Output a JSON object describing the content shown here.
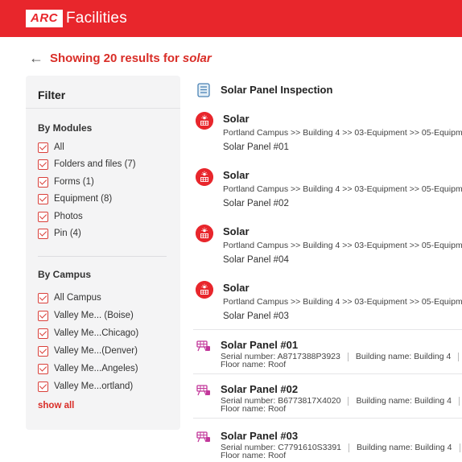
{
  "app": {
    "logo_box": "ARC",
    "logo_text": "Facilities",
    "brand_color": "#e8262c"
  },
  "header": {
    "back_icon": "arrow-left-icon",
    "results_text": "Showing 20 results for",
    "query": "solar"
  },
  "filter": {
    "title": "Filter",
    "modules": {
      "title": "By Modules",
      "items": [
        {
          "label": "All",
          "checked": true
        },
        {
          "label": "Folders and files (7)",
          "checked": true
        },
        {
          "label": "Forms (1)",
          "checked": true
        },
        {
          "label": "Equipment (8)",
          "checked": true
        },
        {
          "label": "Photos",
          "checked": true
        },
        {
          "label": "Pin (4)",
          "checked": true
        }
      ]
    },
    "campus": {
      "title": "By Campus",
      "items": [
        {
          "label": "All Campus",
          "checked": true
        },
        {
          "label": "Valley Me... (Boise)",
          "checked": true
        },
        {
          "label": "Valley Me...Chicago)",
          "checked": true
        },
        {
          "label": "Valley Me...(Denver)",
          "checked": true
        },
        {
          "label": "Valley Me...Angeles)",
          "checked": true
        },
        {
          "label": "Valley Me...ortland)",
          "checked": true
        }
      ],
      "show_all": "show all"
    }
  },
  "results": {
    "form": {
      "title": "Solar Panel Inspection",
      "icon": "form-document-icon"
    },
    "pins": [
      {
        "title": "Solar",
        "path": "Portland Campus >> Building 4 >> 03-Equipment >> 05-Equipme",
        "sub": "Solar Panel #01",
        "icon": "solar-pin-icon"
      },
      {
        "title": "Solar",
        "path": "Portland Campus >> Building 4 >> 03-Equipment >> 05-Equipme",
        "sub": "Solar Panel #02",
        "icon": "solar-pin-icon"
      },
      {
        "title": "Solar",
        "path": "Portland Campus >> Building 4 >> 03-Equipment >> 05-Equipme",
        "sub": "Solar Panel #04",
        "icon": "solar-pin-icon"
      },
      {
        "title": "Solar",
        "path": "Portland Campus >> Building 4 >> 03-Equipment >> 05-Equipme",
        "sub": "Solar Panel #03",
        "icon": "solar-pin-icon"
      }
    ],
    "equipment": [
      {
        "title": "Solar Panel #01",
        "serial": "Serial number: A8717388P3923",
        "building": "Building name: Building 4",
        "floor": "Floor name: Roof",
        "icon": "solar-panel-equipment-icon"
      },
      {
        "title": "Solar Panel #02",
        "serial": "Serial number: B6773817X4020",
        "building": "Building name: Building 4",
        "floor": "Floor name: Roof",
        "icon": "solar-panel-equipment-icon"
      },
      {
        "title": "Solar Panel #03",
        "serial": "Serial number: C7791610S3391",
        "building": "Building name: Building 4",
        "floor": "Floor name: Roof",
        "icon": "solar-panel-equipment-icon"
      }
    ]
  }
}
